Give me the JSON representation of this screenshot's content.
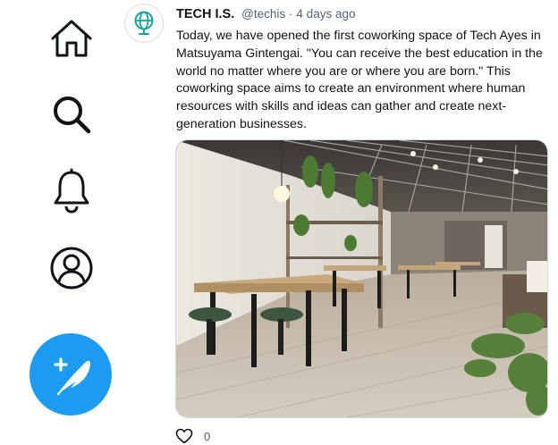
{
  "nav": {
    "items": [
      {
        "icon": "home-icon"
      },
      {
        "icon": "search-icon"
      },
      {
        "icon": "bell-icon"
      },
      {
        "icon": "profile-icon"
      }
    ],
    "compose_icon": "compose-feather-icon",
    "accent": "#1d9bf0"
  },
  "tweet": {
    "name": "TECH I.S.",
    "handle": "@techis",
    "separator": "·",
    "time": "4 days ago",
    "text": "Today, we have opened the first coworking space of Tech Ayes in Matsuyama Gintengai. \"You can receive the best education in the world no matter where you are or where you are born.\" This coworking space aims to create an environment where human resources with skills and ideas can gather and create next-generation businesses.",
    "avatar_logo_color": "#1aa39a",
    "like_icon": "heart-icon",
    "like_count": "0"
  }
}
